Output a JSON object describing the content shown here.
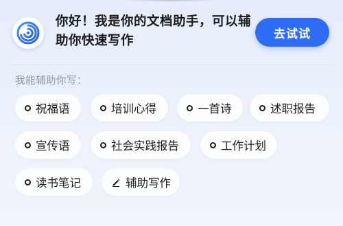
{
  "header": {
    "greeting": "你好！我是你的文档助手，可以辅助你快速写作",
    "try_button": "去试试"
  },
  "section": {
    "label": "我能辅助你写："
  },
  "chips": {
    "row1": [
      "祝福语",
      "培训心得",
      "一首诗",
      "述职报告"
    ],
    "row2": [
      "宣传语",
      "社会实践报告",
      "工作计划"
    ],
    "row3": [
      "读书笔记",
      "辅助写作"
    ]
  },
  "colors": {
    "accent": "#2f6cf6",
    "label_gray": "#8e95a6",
    "background": "#e9f0fb"
  },
  "icons": {
    "logo": "spiral-logo-icon",
    "chip_bullet": "circle-bullet-icon",
    "assist_write": "pen-icon"
  }
}
